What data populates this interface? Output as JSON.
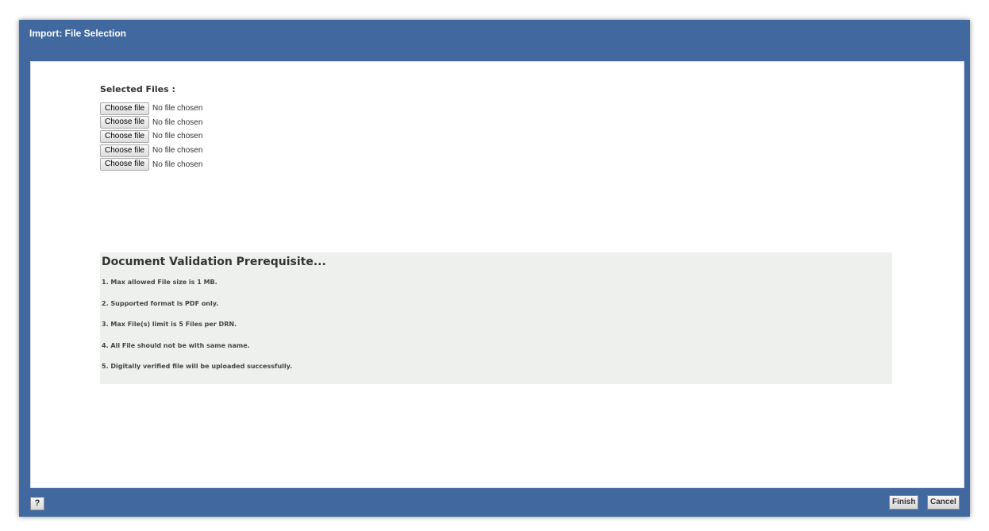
{
  "dialog": {
    "title": "Import: File Selection"
  },
  "files": {
    "label": "Selected Files :",
    "rows": [
      {
        "button": "Choose file",
        "status": "No file chosen"
      },
      {
        "button": "Choose file",
        "status": "No file chosen"
      },
      {
        "button": "Choose file",
        "status": "No file chosen"
      },
      {
        "button": "Choose file",
        "status": "No file chosen"
      },
      {
        "button": "Choose file",
        "status": "No file chosen"
      }
    ]
  },
  "prerequisites": {
    "title": "Document Validation Prerequisite...",
    "items": [
      "1. Max allowed File size is 1 MB.",
      "2. Supported format is PDF only.",
      "3. Max File(s) limit is 5 Files per DRN.",
      "4. All File should not be with same name.",
      "5. Digitally verified file will be uploaded successfully."
    ]
  },
  "footer": {
    "help_label": "?",
    "finish_label": "Finish",
    "cancel_label": "Cancel"
  },
  "colors": {
    "header": "#4169a0",
    "panel": "#eef0ee"
  }
}
